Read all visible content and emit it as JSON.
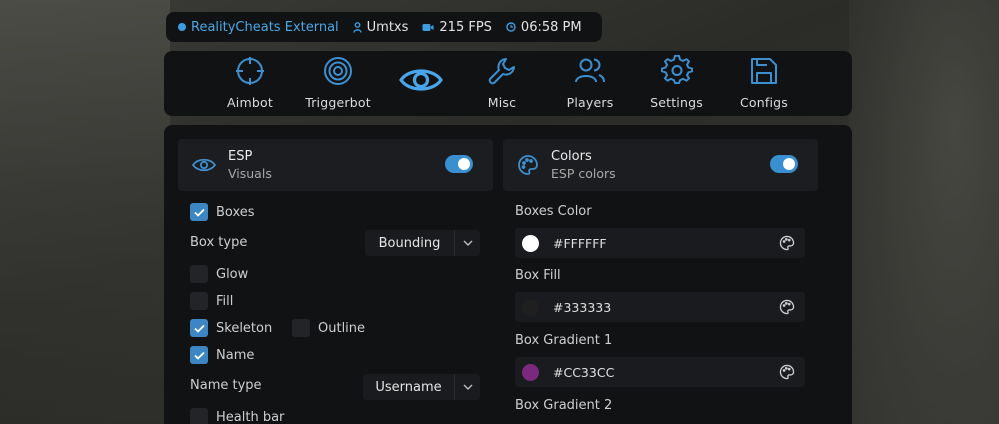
{
  "status": {
    "brand": "RealityCheats External",
    "user": "Umtxs",
    "fps": "215 FPS",
    "time": "06:58 PM"
  },
  "nav": {
    "items": [
      {
        "label": "Aimbot",
        "icon": "crosshair-icon"
      },
      {
        "label": "Triggerbot",
        "icon": "target-icon"
      },
      {
        "label": "",
        "icon": "eye-icon",
        "active": true
      },
      {
        "label": "Misc",
        "icon": "wrench-icon"
      },
      {
        "label": "Players",
        "icon": "users-icon"
      },
      {
        "label": "Settings",
        "icon": "gear-icon"
      },
      {
        "label": "Configs",
        "icon": "save-icon"
      }
    ]
  },
  "esp": {
    "title": "ESP",
    "subtitle": "Visuals",
    "enabled": true,
    "boxes": {
      "label": "Boxes",
      "checked": true
    },
    "box_type": {
      "label": "Box type",
      "value": "Bounding"
    },
    "glow": {
      "label": "Glow",
      "checked": false
    },
    "fill": {
      "label": "Fill",
      "checked": false
    },
    "skeleton": {
      "label": "Skeleton",
      "checked": true
    },
    "outline": {
      "label": "Outline",
      "checked": false
    },
    "name": {
      "label": "Name",
      "checked": true
    },
    "name_type": {
      "label": "Name type",
      "value": "Username"
    },
    "health_bar": {
      "label": "Health bar",
      "checked": false
    }
  },
  "colors": {
    "title": "Colors",
    "subtitle": "ESP colors",
    "enabled": true,
    "items": [
      {
        "label": "Boxes Color",
        "hex": "#FFFFFF",
        "swatch": "#ffffff"
      },
      {
        "label": "Box Fill",
        "hex": "#333333",
        "swatch": "#1f1f1f"
      },
      {
        "label": "Box Gradient 1",
        "hex": "#CC33CC",
        "swatch": "#7a2a7c"
      },
      {
        "label": "Box Gradient 2"
      }
    ]
  },
  "theme": {
    "accent": "#3d9de0",
    "panel": "#111214",
    "card": "#1c1d20"
  }
}
